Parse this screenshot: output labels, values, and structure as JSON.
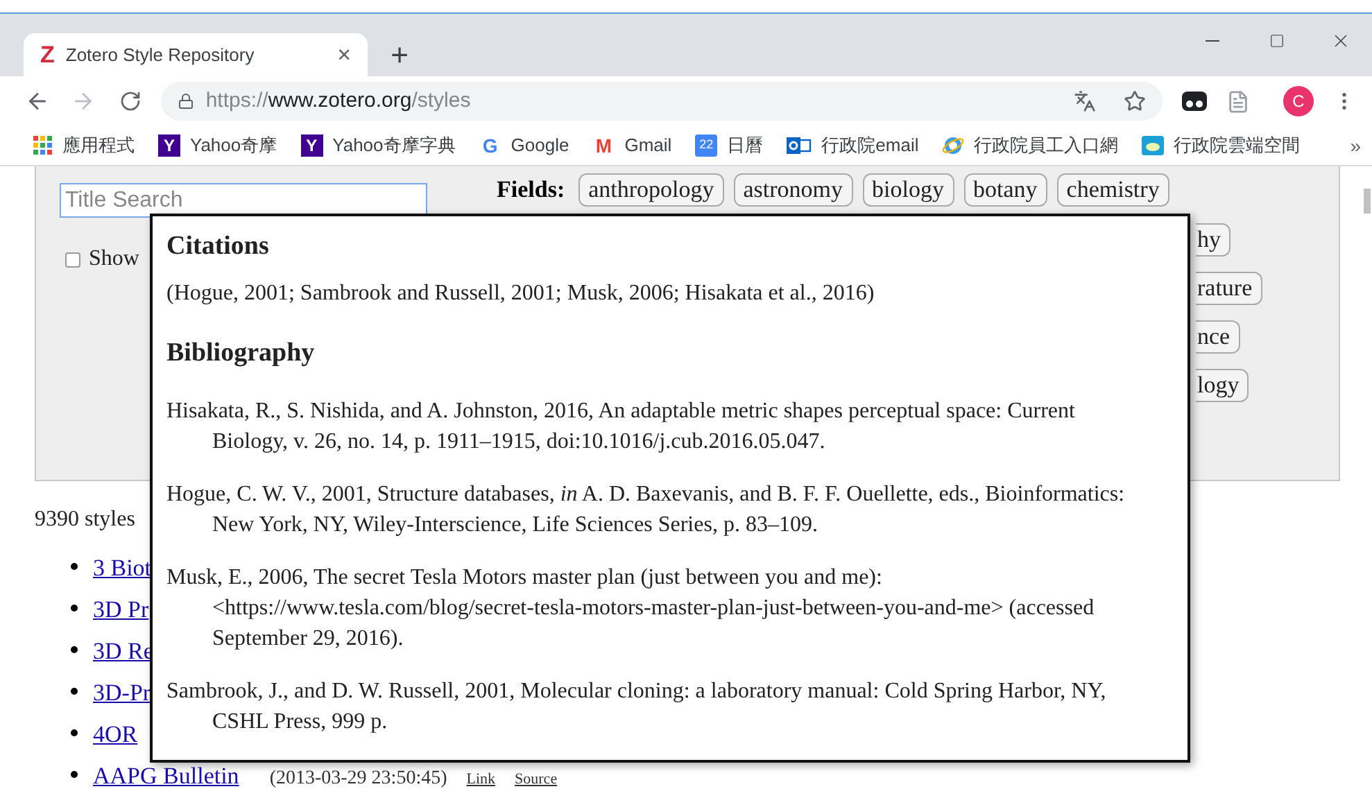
{
  "tab": {
    "favicon": "Z",
    "title": "Zotero Style Repository",
    "close": "×",
    "selected": true
  },
  "new_tab": "+",
  "address_bar": {
    "scheme": "https://",
    "domain": "www.zotero.org",
    "path": "/styles"
  },
  "profile": {
    "initial": "C"
  },
  "bookmarks": [
    {
      "kind": "apps",
      "label": "應用程式"
    },
    {
      "kind": "letter",
      "icon_text": "Y",
      "color": "#400090",
      "label": "Yahoo奇摩"
    },
    {
      "kind": "letter",
      "icon_text": "Y",
      "color": "#400090",
      "label": "Yahoo奇摩字典"
    },
    {
      "kind": "google",
      "icon_text": "G",
      "label": "Google"
    },
    {
      "kind": "gmail",
      "icon_text": "M",
      "label": "Gmail"
    },
    {
      "kind": "calendar",
      "icon_text": "22",
      "label": "日曆"
    },
    {
      "kind": "outlook",
      "label": "行政院email"
    },
    {
      "kind": "ie",
      "label": "行政院員工入口網"
    },
    {
      "kind": "cloud",
      "label": "行政院雲端空間"
    }
  ],
  "bookmarks_more": "»",
  "search": {
    "placeholder": "Title Search"
  },
  "show_option": {
    "label": "Show",
    "checked": false
  },
  "fields": {
    "label": "Fields:",
    "chips": [
      "anthropology",
      "astronomy",
      "biology",
      "botany",
      "chemistry"
    ],
    "partial_chips": [
      "hy",
      "rature",
      "nce",
      "logy"
    ]
  },
  "style_count": "9390 styles",
  "styles": [
    {
      "title": "3 Biot"
    },
    {
      "title": "3D Pr"
    },
    {
      "title": "3D Re"
    },
    {
      "title": "3D-Pr"
    },
    {
      "title": "4OR"
    },
    {
      "title": "AAPG Bulletin",
      "date": "(2013-03-29 23:50:45)",
      "links": [
        "Link",
        "Source"
      ]
    }
  ],
  "preview": {
    "citations_heading": "Citations",
    "citation": "(Hogue, 2001; Sambrook and Russell, 2001; Musk, 2006; Hisakata et al., 2016)",
    "bibliography_heading": "Bibliography",
    "entries": [
      "Hisakata, R., S. Nishida, and A. Johnston, 2016, An adaptable metric shapes perceptual space: Current Biology, v. 26, no. 14, p. 1911–1915, doi:10.1016/j.cub.2016.05.047.",
      "Hogue, C. W. V., 2001, Structure databases, *in* A. D. Baxevanis, and B. F. F. Ouellette, eds., Bioinformatics: New York, NY, Wiley-Interscience, Life Sciences Series, p. 83–109.",
      "Musk, E., 2006, The secret Tesla Motors master plan (just between you and me): <https://www.tesla.com/blog/secret-tesla-motors-master-plan-just-between-you-and-me> (accessed September 29, 2016).",
      "Sambrook, J., and D. W. Russell, 2001, Molecular cloning: a laboratory manual: Cold Spring Harbor, NY, CSHL Press, 999 p."
    ]
  }
}
